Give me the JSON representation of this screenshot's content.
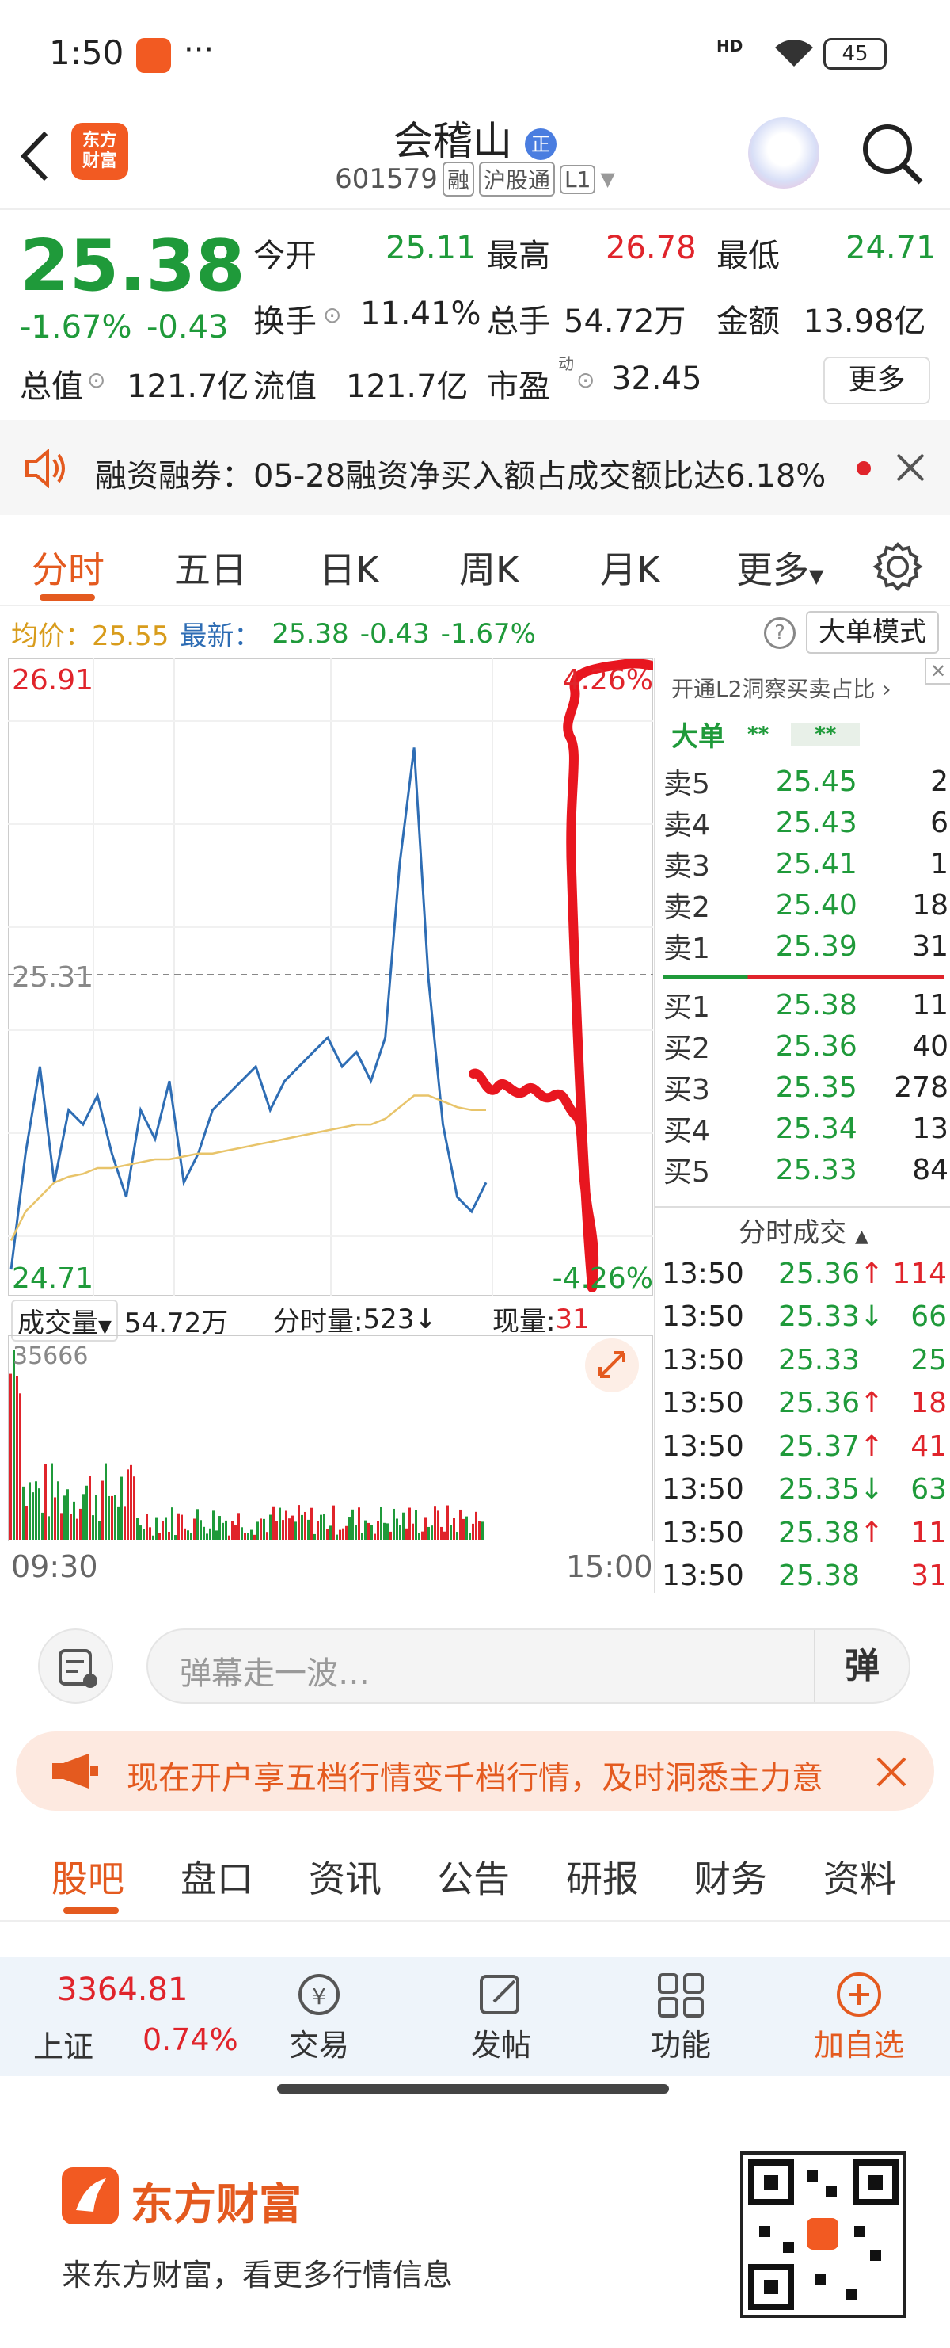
{
  "status_bar": {
    "time": "1:50",
    "more": "···",
    "battery": "45",
    "signal_tag": "HD"
  },
  "header": {
    "title": "会稽山",
    "badge": "正",
    "code": "601579",
    "tag_rong": "融",
    "tag_hgt": "沪股通",
    "tag_level": "L1",
    "logo_line1": "东方",
    "logo_line2": "财富"
  },
  "quote": {
    "price": "25.38",
    "change_pct": "-1.67%",
    "change_amt": "-0.43",
    "open_label": "今开",
    "open": "25.11",
    "high_label": "最高",
    "high": "26.78",
    "low_label": "最低",
    "low": "24.71",
    "turnover_label": "换手",
    "turnover": "11.41%",
    "volume_label": "总手",
    "volume": "54.72万",
    "amount_label": "金额",
    "amount": "13.98亿",
    "mktcap_label": "总值",
    "mktcap": "121.7亿",
    "float_label": "流值",
    "float": "121.7亿",
    "pe_label": "市盈",
    "pe_sup": "动",
    "pe": "32.45",
    "more_button": "更多"
  },
  "notice": {
    "text": "融资融券：05-28融资净买入额占成交额比达6.18%"
  },
  "tabs": [
    "分时",
    "五日",
    "日K",
    "周K",
    "月K",
    "更多"
  ],
  "chart": {
    "avg_label": "均价：",
    "avg": "25.55",
    "last_label": "最新：",
    "last": "25.38",
    "last_chg": "-0.43",
    "last_pct": "-1.67%",
    "mode_button": "大单模式",
    "y_top": "26.91",
    "y_mid": "25.31",
    "y_bot": "24.71",
    "pct_top": "4.26%",
    "pct_bot": "-4.26%",
    "vol_label": "成交量",
    "vol_total": "54.72万",
    "fs_label": "分时量:",
    "fs_value": "523",
    "cur_label": "现量:",
    "cur_value": "31",
    "vol_max": "35666",
    "t_start": "09:30",
    "t_end": "15:00"
  },
  "chart_data": {
    "type": "line",
    "title": "",
    "ylim": [
      24.71,
      26.91
    ],
    "x_start": "09:30",
    "x_end": "15:00",
    "series": [
      {
        "name": "最新",
        "values": [
          24.8,
          25.2,
          25.5,
          25.1,
          25.35,
          25.3,
          25.4,
          25.2,
          25.05,
          25.35,
          25.25,
          25.45,
          25.1,
          25.2,
          25.35,
          25.4,
          25.45,
          25.5,
          25.35,
          25.45,
          25.5,
          25.55,
          25.6,
          25.5,
          25.55,
          25.45,
          25.6,
          26.2,
          26.6,
          25.8,
          25.3,
          25.05,
          25.0,
          25.1
        ]
      },
      {
        "name": "均价",
        "values": [
          24.9,
          25.0,
          25.05,
          25.1,
          25.12,
          25.13,
          25.15,
          25.15,
          25.16,
          25.17,
          25.18,
          25.18,
          25.19,
          25.2,
          25.2,
          25.21,
          25.22,
          25.23,
          25.24,
          25.25,
          25.26,
          25.27,
          25.28,
          25.29,
          25.3,
          25.3,
          25.32,
          25.36,
          25.4,
          25.4,
          25.38,
          25.36,
          25.35,
          25.35
        ]
      }
    ]
  },
  "order_book": {
    "header": "开通L2洞察买卖占比",
    "big_label": "大单",
    "big_v1": "**",
    "big_v2": "**",
    "asks": [
      {
        "label": "卖5",
        "price": "25.45",
        "vol": "2"
      },
      {
        "label": "卖4",
        "price": "25.43",
        "vol": "6"
      },
      {
        "label": "卖3",
        "price": "25.41",
        "vol": "1"
      },
      {
        "label": "卖2",
        "price": "25.40",
        "vol": "18"
      },
      {
        "label": "卖1",
        "price": "25.39",
        "vol": "31"
      }
    ],
    "bids": [
      {
        "label": "买1",
        "price": "25.38",
        "vol": "11"
      },
      {
        "label": "买2",
        "price": "25.36",
        "vol": "40"
      },
      {
        "label": "买3",
        "price": "25.35",
        "vol": "278"
      },
      {
        "label": "买4",
        "price": "25.34",
        "vol": "13"
      },
      {
        "label": "买5",
        "price": "25.33",
        "vol": "84"
      }
    ],
    "trades_header": "分时成交",
    "trades": [
      {
        "time": "13:50",
        "price": "25.36",
        "dir": "↑",
        "vol": "114"
      },
      {
        "time": "13:50",
        "price": "25.33",
        "dir": "↓",
        "vol": "66"
      },
      {
        "time": "13:50",
        "price": "25.33",
        "dir": "",
        "vol": "25"
      },
      {
        "time": "13:50",
        "price": "25.36",
        "dir": "↑",
        "vol": "18"
      },
      {
        "time": "13:50",
        "price": "25.37",
        "dir": "↑",
        "vol": "41"
      },
      {
        "time": "13:50",
        "price": "25.35",
        "dir": "↓",
        "vol": "63"
      },
      {
        "time": "13:50",
        "price": "25.38",
        "dir": "↑",
        "vol": "11"
      },
      {
        "time": "13:50",
        "price": "25.38",
        "dir": "",
        "vol": "31"
      }
    ]
  },
  "danmu": {
    "placeholder": "弹幕走一波…",
    "button": "弹"
  },
  "ad": {
    "text": "现在开户享五档行情变千档行情，及时洞悉主力意"
  },
  "subtabs": [
    "股吧",
    "盘口",
    "资讯",
    "公告",
    "研报",
    "财务",
    "资料"
  ],
  "bottom_nav": {
    "index_value": "3364.81",
    "index_name": "上证",
    "index_pct": "0.74%",
    "trade": "交易",
    "post": "发帖",
    "func": "功能",
    "watch": "加自选"
  },
  "footer": {
    "brand": "东方财富",
    "slogan": "来东方财富，看更多行情信息"
  },
  "colors": {
    "up": "#e0242b",
    "down": "#1f9a3a",
    "accent": "#e45a1f",
    "price_line": "#2e6db4",
    "avg_line": "#e8c46a"
  }
}
